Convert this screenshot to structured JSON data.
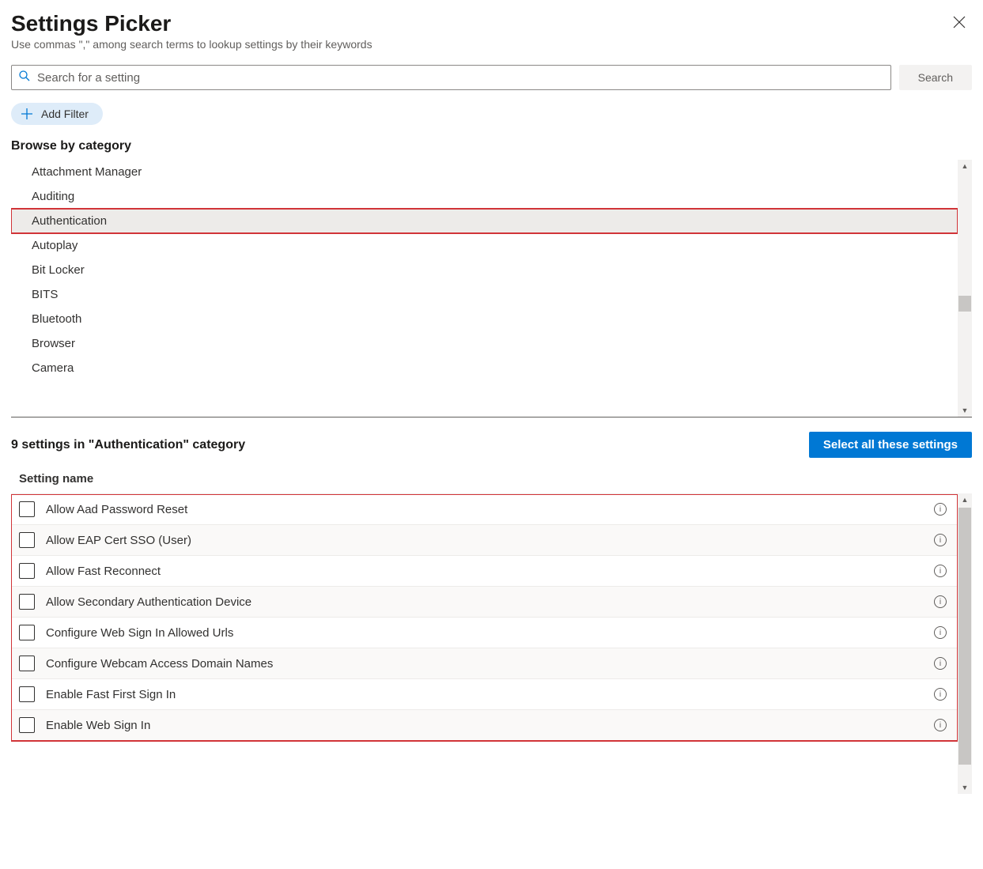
{
  "header": {
    "title": "Settings Picker",
    "subtitle": "Use commas \",\" among search terms to lookup settings by their keywords"
  },
  "search": {
    "placeholder": "Search for a setting",
    "button_label": "Search"
  },
  "add_filter_label": "Add Filter",
  "browse_heading": "Browse by category",
  "categories": [
    "Attachment Manager",
    "Auditing",
    "Authentication",
    "Autoplay",
    "Bit Locker",
    "BITS",
    "Bluetooth",
    "Browser",
    "Camera"
  ],
  "selected_category_index": 2,
  "settings_count_label": "9 settings in \"Authentication\" category",
  "select_all_label": "Select all these settings",
  "column_header": "Setting name",
  "settings": [
    "Allow Aad Password Reset",
    "Allow EAP Cert SSO (User)",
    "Allow Fast Reconnect",
    "Allow Secondary Authentication Device",
    "Configure Web Sign In Allowed Urls",
    "Configure Webcam Access Domain Names",
    "Enable Fast First Sign In",
    "Enable Web Sign In"
  ]
}
